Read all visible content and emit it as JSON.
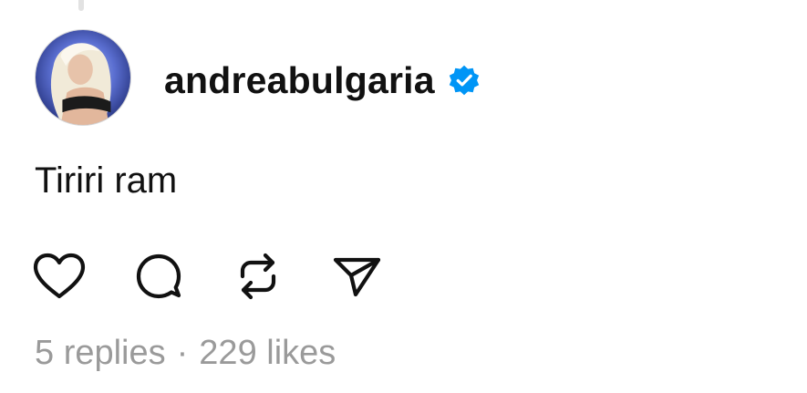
{
  "post": {
    "username": "andreabulgaria",
    "verified": true,
    "text": "Tiriri ram"
  },
  "actions": [
    {
      "icon": "heart-icon",
      "label": "Like"
    },
    {
      "icon": "comment-icon",
      "label": "Reply"
    },
    {
      "icon": "repost-icon",
      "label": "Repost"
    },
    {
      "icon": "send-icon",
      "label": "Share"
    }
  ],
  "stats": {
    "replies": "5 replies",
    "separator": "·",
    "likes": "229 likes"
  },
  "colors": {
    "text": "#111111",
    "muted": "#9a9a9a",
    "verified": "#0095f6"
  }
}
